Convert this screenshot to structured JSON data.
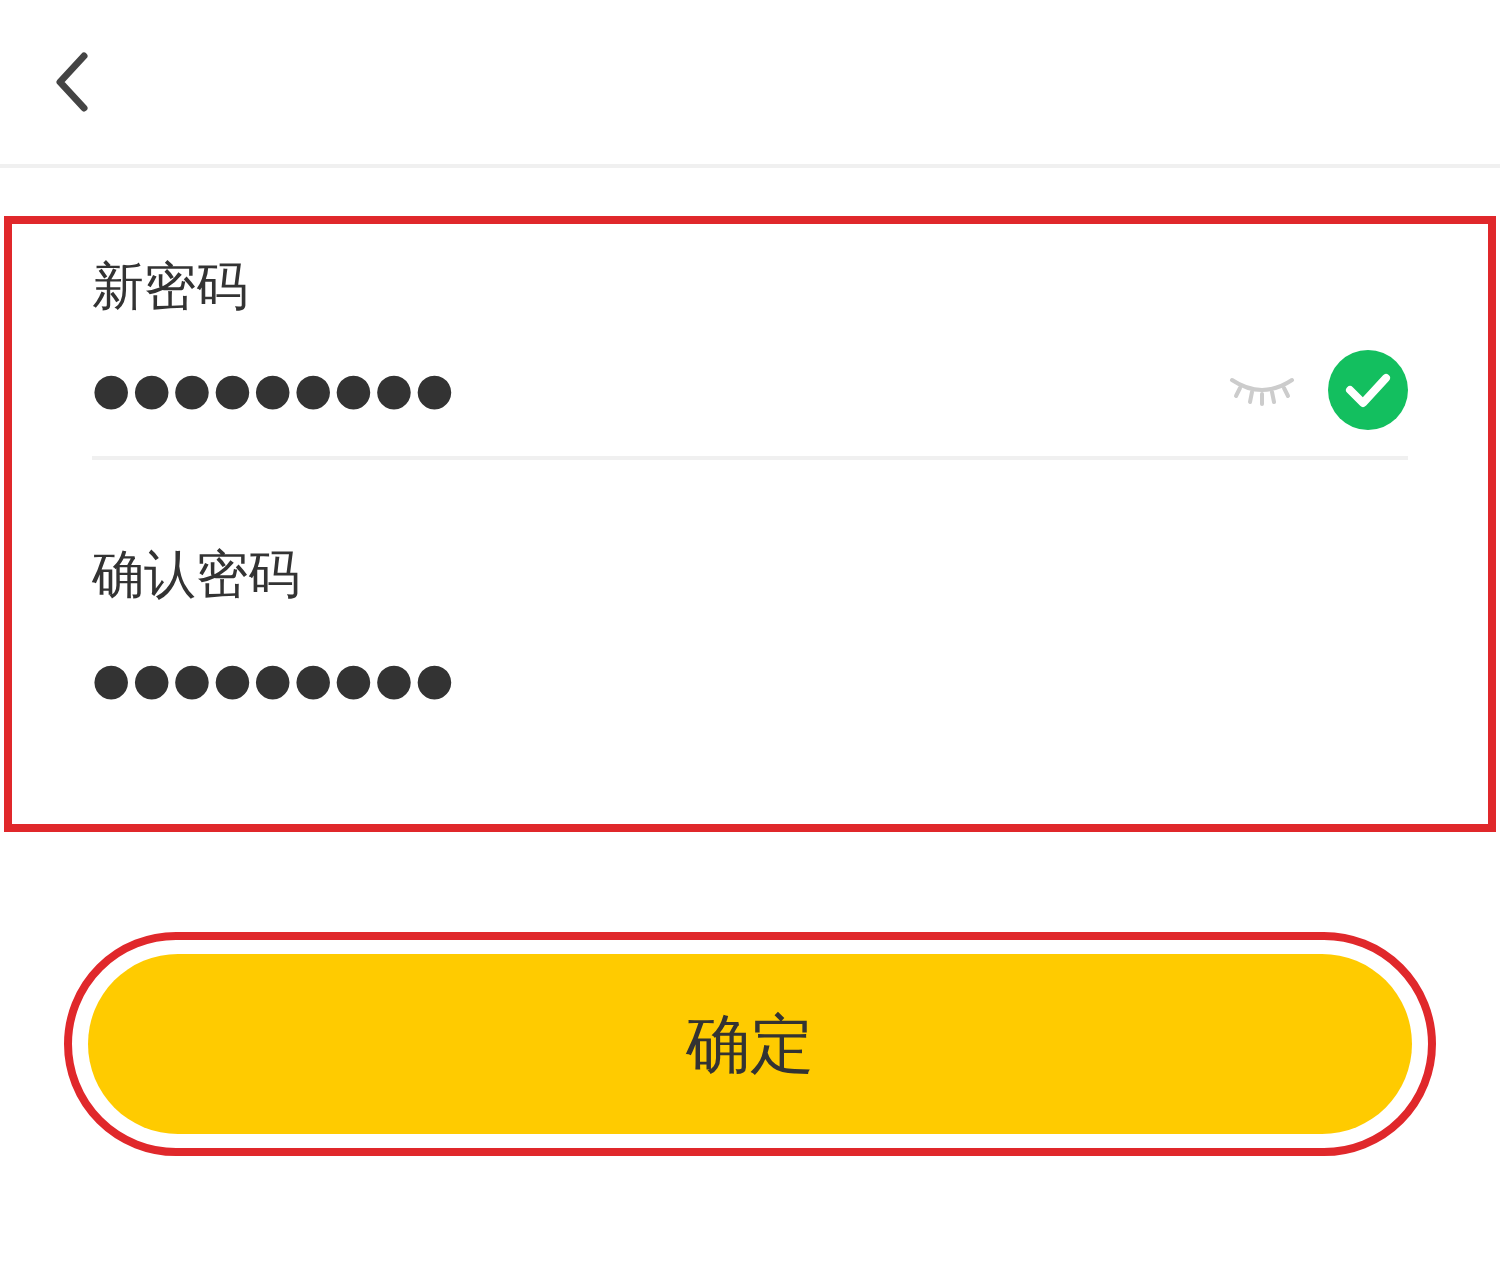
{
  "fields": [
    {
      "label": "新密码",
      "value": "●●●●●●●●●",
      "show_toggle": true,
      "visible": false,
      "valid": true
    },
    {
      "label": "确认密码",
      "value": "●●●●●●●●●",
      "show_toggle": false,
      "visible": false,
      "valid": false
    }
  ],
  "submit": {
    "label": "确定"
  }
}
